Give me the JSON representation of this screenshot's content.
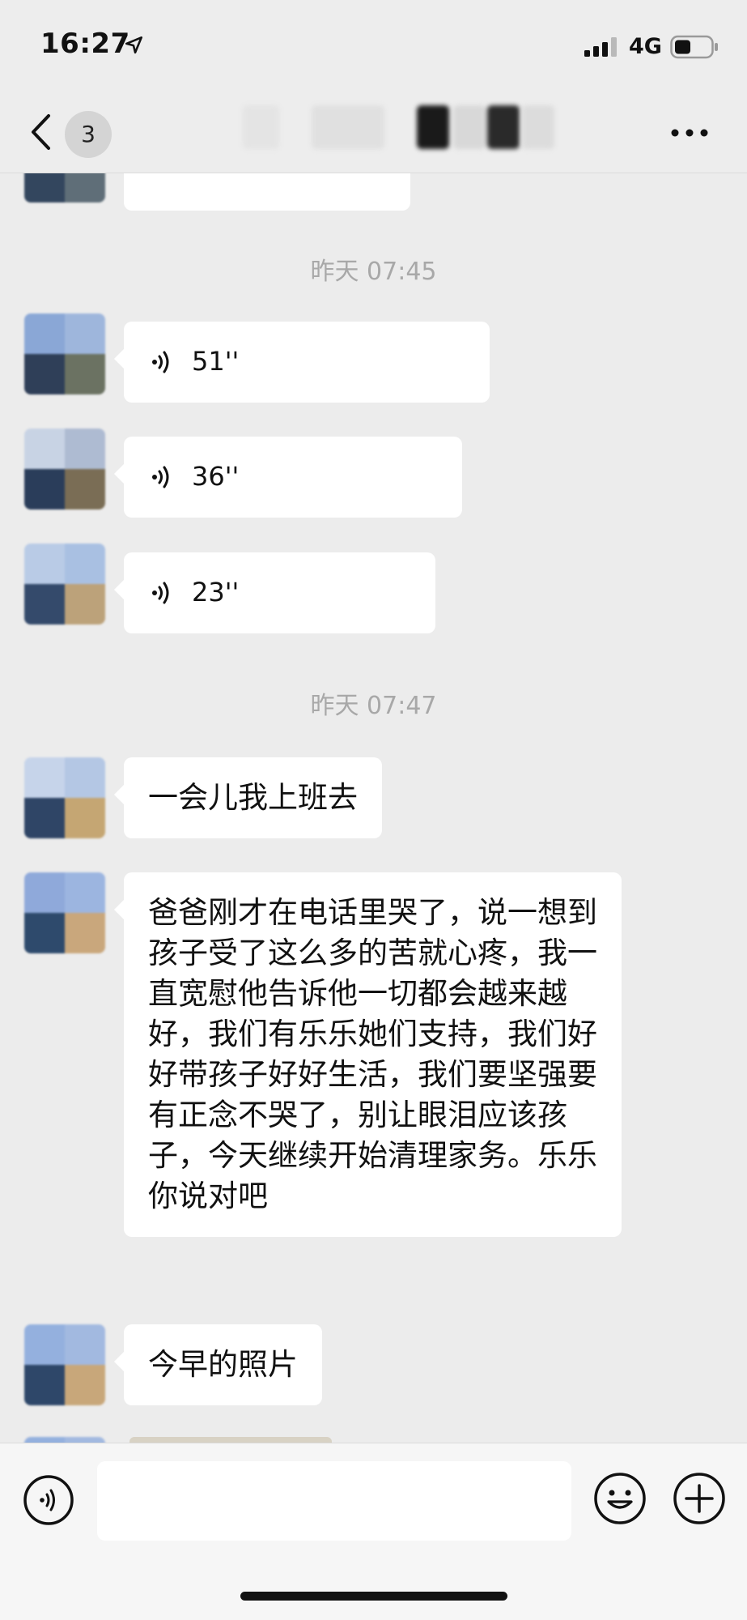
{
  "status_bar": {
    "time": "16:27",
    "network": "4G"
  },
  "nav": {
    "unread_count": "3"
  },
  "messages": [
    {
      "timestamp": "昨天 07:45"
    },
    {
      "voice_duration": "51''"
    },
    {
      "voice_duration": "36''"
    },
    {
      "voice_duration": "23''"
    },
    {
      "timestamp": "昨天 07:47"
    },
    {
      "text": "一会儿我上班去"
    },
    {
      "text": "爸爸刚才在电话里哭了，说一想到孩子受了这么多的苦就心疼，我一直宽慰他告诉他一切都会越来越好，我们有乐乐她们支持，我们好好带孩子好好生活，我们要坚强要有正念不哭了，别让眼泪应该孩子，今天继续开始清理家务。乐乐你说对吧"
    },
    {
      "text": "今早的照片"
    }
  ],
  "input": {
    "placeholder": ""
  },
  "icons": {
    "back": "chevron-left-icon",
    "more": "more-dots-icon",
    "voice": "voice-wave-icon",
    "emoji": "emoji-icon",
    "plus": "plus-icon"
  },
  "colors": {
    "background": "#ececec",
    "bubble": "#ffffff",
    "timestamp": "#a8a8a8"
  }
}
